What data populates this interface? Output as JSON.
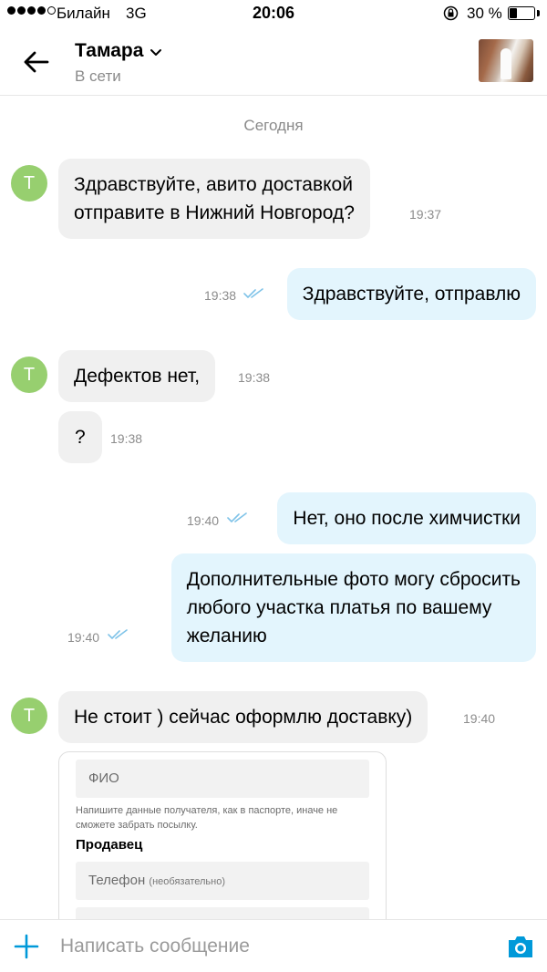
{
  "status_bar": {
    "carrier": "Билайн",
    "network": "3G",
    "time": "20:06",
    "battery": "30 %",
    "battery_level": 0.3
  },
  "header": {
    "contact_name": "Тамара",
    "contact_status": "В сети"
  },
  "chat": {
    "date_label": "Сегодня",
    "avatar_letter": "Т",
    "messages": [
      {
        "direction": "in",
        "text": "Здравствуйте, авито доставкой\nотправите в Нижний Новгород?",
        "time": "19:37"
      },
      {
        "direction": "out",
        "text": "Здравствуйте, отправлю",
        "time": "19:38",
        "read": true
      },
      {
        "direction": "in",
        "text": "Дефектов нет,",
        "time": "19:38"
      },
      {
        "direction": "in",
        "text": "?",
        "time": "19:38"
      },
      {
        "direction": "out",
        "text": "Нет, оно после химчистки",
        "time": "19:40",
        "read": true
      },
      {
        "direction": "out",
        "text": "Дополнительные фото могу сбросить\nлюбого участка платья по вашему\nжеланию",
        "time": "19:40",
        "read": true
      },
      {
        "direction": "in",
        "text": "Не стоит ) сейчас оформлю доставку)",
        "time": "19:40"
      }
    ],
    "form_card": {
      "fio_placeholder": "ФИО",
      "hint": "Напишите данные получателя, как в паспорте, иначе не сможете забрать посылку.",
      "section_title": "Продавец",
      "phone_label": "Телефон",
      "phone_optional": "(необязательно)"
    }
  },
  "input_bar": {
    "placeholder": "Написать сообщение"
  },
  "colors": {
    "accent": "#0099d9",
    "incoming_bubble": "#f0f0f0",
    "outgoing_bubble": "#e3f5fd",
    "avatar": "#97cf6f",
    "read_ticks": "#7fc3e8"
  },
  "icons": [
    "back-arrow-icon",
    "chevron-down-icon",
    "plus-icon",
    "camera-icon",
    "read-ticks-icon",
    "rotation-lock-icon"
  ]
}
